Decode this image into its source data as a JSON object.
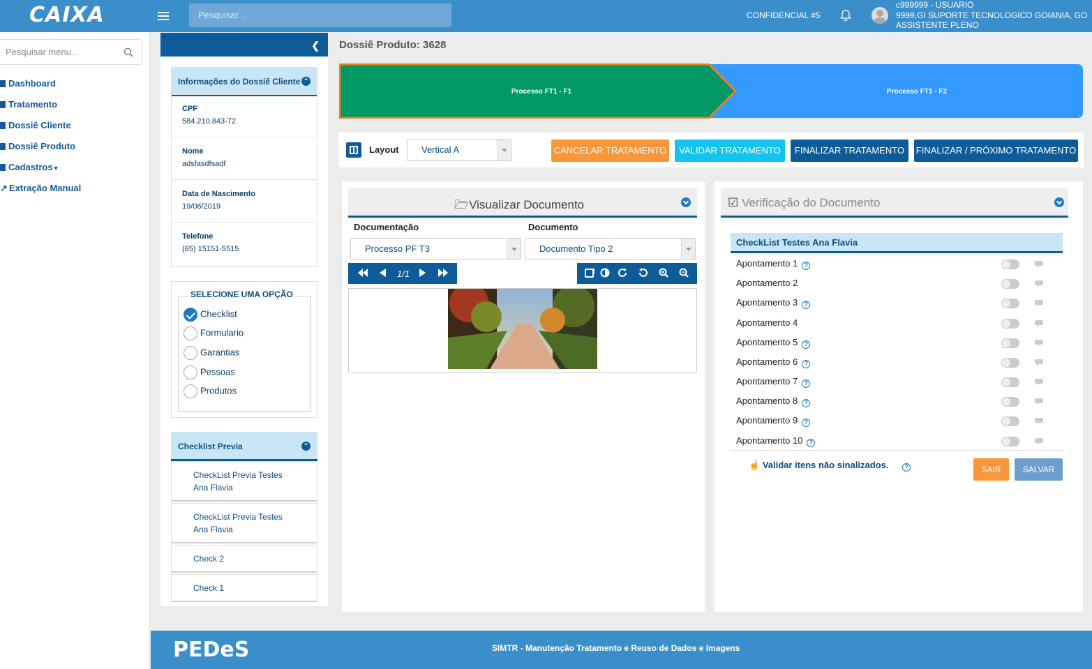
{
  "header": {
    "logo": "CAIXA",
    "search_placeholder": "Pesquisar...",
    "confidencial": "CONFIDENCIAL #5",
    "user_line1": "c999999 - USUARIO",
    "user_line2": "9999,GI SUPORTE TECNOLOGICO GOIANIA, GO",
    "user_line3": "ASSISTENTE PLENO"
  },
  "sidebar": {
    "search_placeholder": "Pesquisar menu...",
    "items": [
      {
        "label": "Dashboard"
      },
      {
        "label": "Tratamento"
      },
      {
        "label": "Dossiê Cliente"
      },
      {
        "label": "Dossiê Produto"
      },
      {
        "label": "Cadastros"
      },
      {
        "label": "Extração Manual"
      }
    ]
  },
  "cliente": {
    "title": "Informações do Dossiê Cliente",
    "fields": [
      {
        "label": "CPF",
        "value": "584.210.843-72"
      },
      {
        "label": "Nome",
        "value": "adsfasdfsadf"
      },
      {
        "label": "Data de Nascimento",
        "value": "19/06/2019"
      },
      {
        "label": "Telefone",
        "value": "(65) 15151-5515"
      }
    ]
  },
  "opcoes": {
    "legend": "SELECIONE UMA OPÇÃO",
    "items": [
      "Checklist",
      "Formulario",
      "Garantias",
      "Pessoas",
      "Produtos"
    ],
    "selected": "Checklist"
  },
  "checklist_previa": {
    "title": "Checklist Previa",
    "items": [
      "CheckList Previa Testes Ana Flavia",
      "CheckList Previa Testes Ana Flavia",
      "Check 2",
      "Check 1"
    ]
  },
  "page": {
    "title": "Dossiê Produto: 3628"
  },
  "wizard": {
    "step1": "Processo FT1 - F1",
    "step2": "Processo FT1 - F2",
    "active_color": "#009966",
    "inactive_color": "#3399ff",
    "border_color": "#f07e1b"
  },
  "toolbar": {
    "layout_label": "Layout",
    "layout_value": "Vertical A",
    "btn_cancel": "CANCELAR TRATAMENTO",
    "btn_validate": "VALIDAR TRATAMENTO",
    "btn_finish": "FINALIZAR TRATAMENTO",
    "btn_finish_next": "FINALIZAR / PRÓXIMO TRATAMENTO"
  },
  "viewer": {
    "title": "Visualizar Documento",
    "doc_label": "Documentação",
    "doc_value": "Processo PF T3",
    "tipo_label": "Documento",
    "tipo_value": "Documento Tipo 2",
    "page_indicator": "1/1"
  },
  "verificacao": {
    "title": "Verificação do Documento",
    "checklist_title": "CheckList Testes Ana Flavia",
    "items": [
      {
        "label": "Apontamento 1",
        "help": true
      },
      {
        "label": "Apontamento 2",
        "help": false
      },
      {
        "label": "Apontamento 3",
        "help": true
      },
      {
        "label": "Apontamento 4",
        "help": false
      },
      {
        "label": "Apontamento 5",
        "help": true
      },
      {
        "label": "Apontamento 6",
        "help": true
      },
      {
        "label": "Apontamento 7",
        "help": true
      },
      {
        "label": "Apontamento 8",
        "help": true
      },
      {
        "label": "Apontamento 9",
        "help": true
      },
      {
        "label": "Apontamento 10",
        "help": true
      }
    ],
    "validar_link": "Validar itens não sinalizados.",
    "btn_sair": "SAIR",
    "btn_salvar": "SALVAR"
  },
  "footer": {
    "brand": "PEDeS",
    "text": "SIMTR - Manutenção Tratamento e Reuso de Dados e Imagens"
  }
}
